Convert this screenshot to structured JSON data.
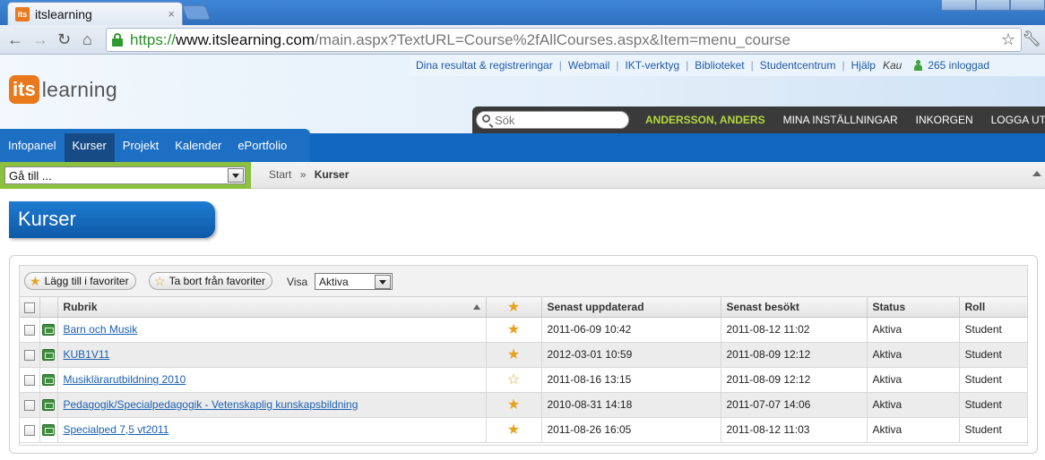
{
  "browser": {
    "tab_title": "itslearning",
    "tab_favicon": "its",
    "url_scheme": "https://",
    "url_host": "www.itslearning.com",
    "url_path": "/main.aspx?TextURL=Course%2fAllCourses.aspx&Item=menu_course"
  },
  "logo": {
    "its": "its",
    "learning": "learning"
  },
  "toplinks": [
    "Dina resultat & registreringar",
    "Webmail",
    "IKT-verktyg",
    "Biblioteket",
    "Studentcentrum",
    "Hjälp"
  ],
  "org": "Kau",
  "online_count": "265 inloggad",
  "search": {
    "placeholder": "Sök"
  },
  "userbar": {
    "username": "ANDERSSON, ANDERS",
    "settings": "MINA INSTÄLLNINGAR",
    "inbox": "INKORGEN",
    "logout": "LOGGA UT"
  },
  "mainnav": [
    "Infopanel",
    "Kurser",
    "Projekt",
    "Kalender",
    "ePortfolio"
  ],
  "goto": {
    "value": "Gå till ..."
  },
  "breadcrumb": {
    "start": "Start",
    "sep": "»",
    "current": "Kurser"
  },
  "page_title": "Kurser",
  "actions": {
    "add_fav": "Lägg till i favoriter",
    "remove_fav": "Ta bort från favoriter",
    "visa_label": "Visa",
    "visa_value": "Aktiva"
  },
  "table": {
    "headers": {
      "rubrik": "Rubrik",
      "updated": "Senast uppdaterad",
      "visited": "Senast besökt",
      "status": "Status",
      "role": "Roll"
    },
    "rows": [
      {
        "title": "Barn och Musik",
        "favorite": true,
        "updated": "2011-06-09 10:42",
        "visited": "2011-08-12 11:02",
        "status": "Aktiva",
        "role": "Student"
      },
      {
        "title": "KUB1V11",
        "favorite": true,
        "updated": "2012-03-01 10:59",
        "visited": "2011-08-09 12:12",
        "status": "Aktiva",
        "role": "Student"
      },
      {
        "title": "Musiklärarutbildning 2010",
        "favorite": false,
        "updated": "2011-08-16 13:15",
        "visited": "2011-08-09 12:12",
        "status": "Aktiva",
        "role": "Student"
      },
      {
        "title": "Pedagogik/Specialpedagogik - Vetenskaplig kunskapsbildning",
        "favorite": true,
        "updated": "2010-08-31 14:18",
        "visited": "2011-07-07 14:06",
        "status": "Aktiva",
        "role": "Student"
      },
      {
        "title": "Specialped 7,5 vt2011",
        "favorite": true,
        "updated": "2011-08-26 16:05",
        "visited": "2011-08-12 11:03",
        "status": "Aktiva",
        "role": "Student"
      }
    ]
  },
  "colors": {
    "accent_blue": "#1166bf",
    "accent_green": "#8cc13f",
    "logo_orange": "#e8791d",
    "star": "#e8a21c"
  }
}
